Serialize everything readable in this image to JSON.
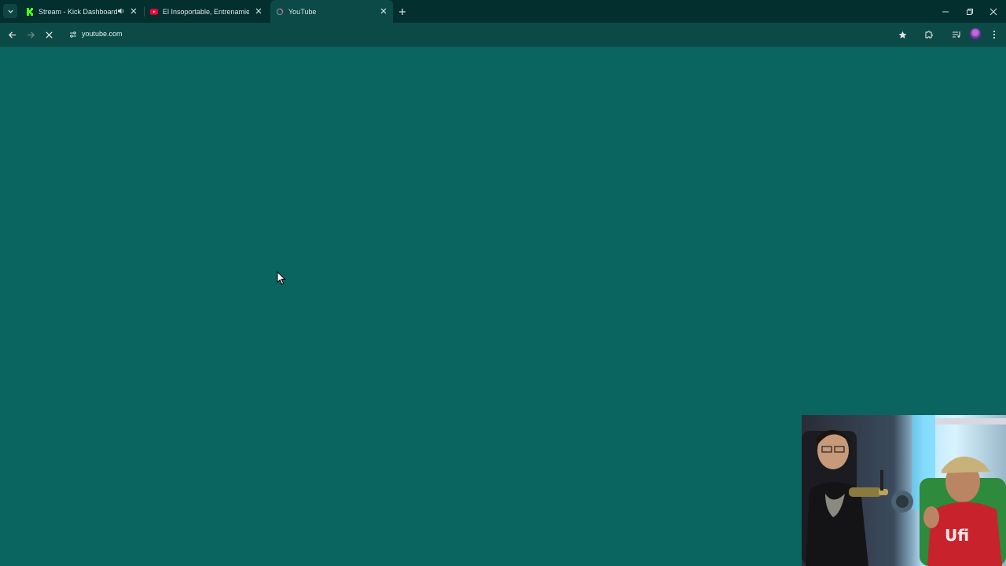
{
  "browser": {
    "tabs": [
      {
        "title": "Stream - Kick Dashboard",
        "favicon": "kick-logo-icon",
        "audio": "speaker-icon",
        "active": false
      },
      {
        "title": "El Insoportable, Entrenamiento",
        "favicon": "youtube-logo-icon",
        "active": false
      },
      {
        "title": "YouTube",
        "favicon": "loading-spinner-icon",
        "active": true
      }
    ],
    "new_tab_icon": "plus-icon",
    "window_controls": [
      "minimize-icon",
      "restore-icon",
      "close-icon"
    ]
  },
  "toolbar": {
    "url": "youtube.com",
    "state": "loading",
    "buttons": [
      "back-icon",
      "forward-icon",
      "stop-loading-icon",
      "site-info-icon",
      "bookmark-star-icon",
      "extensions-icon",
      "media-controls-icon",
      "profile-avatar",
      "more-menu-icon"
    ]
  },
  "page": {
    "state": "blank-loading"
  },
  "overlay": {
    "type": "webcam-feed",
    "description_icon": "webcam-video"
  },
  "colors": {
    "page_bg": "#0a6561",
    "tabstrip_bg": "#03302f",
    "toolbar_bg": "#0c4a47",
    "kick_green": "#53fc18",
    "youtube_red": "#ff0033"
  }
}
